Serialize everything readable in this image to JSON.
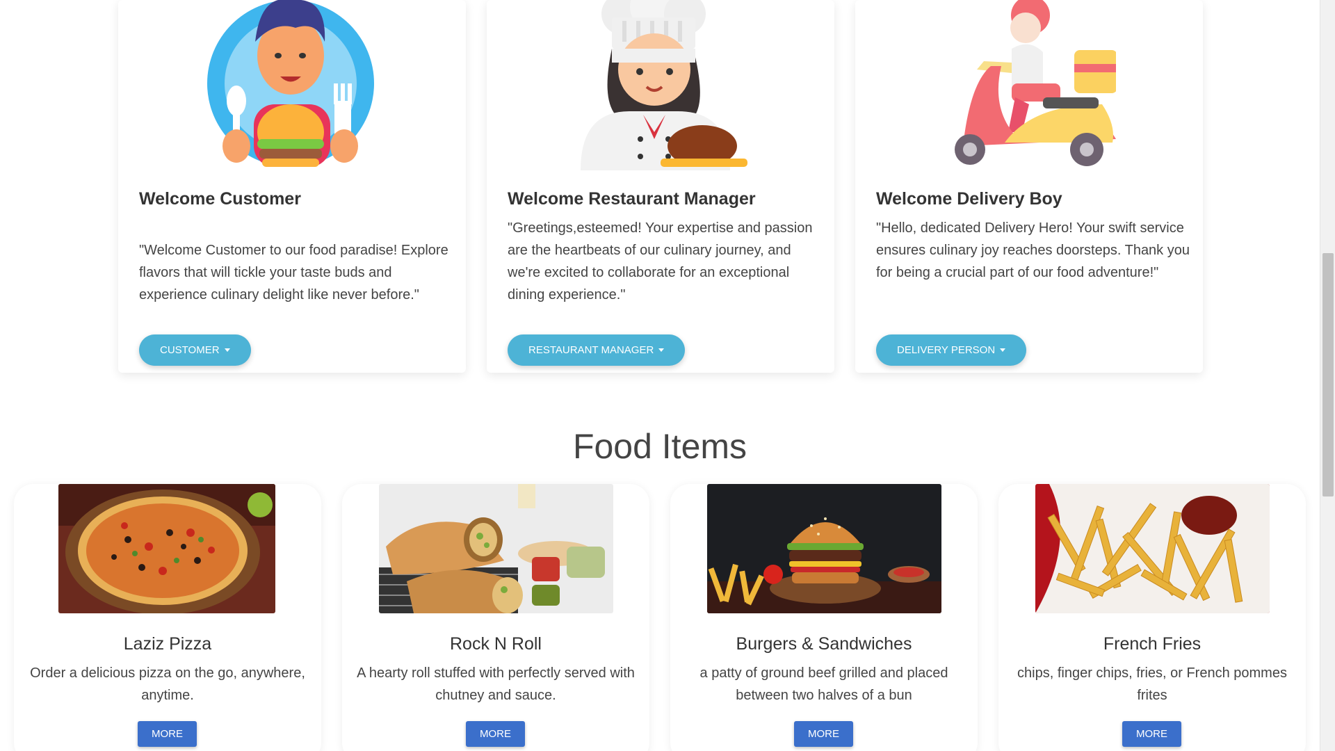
{
  "roles": [
    {
      "title": "Welcome Customer",
      "text": "\"Welcome Customer to our food paradise! Explore flavors that will tickle your taste buds and experience culinary delight like never before.\"",
      "button": "CUSTOMER"
    },
    {
      "title": "Welcome Restaurant Manager",
      "text": "\"Greetings,esteemed! Your expertise and passion are the heartbeats of our culinary journey, and we're excited to collaborate for an exceptional dining experience.\"",
      "button": "RESTAURANT MANAGER"
    },
    {
      "title": "Welcome Delivery Boy",
      "text": "\"Hello, dedicated Delivery Hero! Your swift service ensures culinary joy reaches doorsteps. Thank you for being a crucial part of our food adventure!\"",
      "button": "DELIVERY PERSON"
    }
  ],
  "food_section": {
    "title": "Food Items",
    "items": [
      {
        "name": "Laziz Pizza",
        "description": "Order a delicious pizza on the go, anywhere, anytime.",
        "button": "MORE"
      },
      {
        "name": "Rock N Roll",
        "description": "A hearty roll stuffed with perfectly served with chutney and sauce.",
        "button": "MORE"
      },
      {
        "name": "Burgers & Sandwiches",
        "description": "a patty of ground beef grilled and placed between two halves of a bun",
        "button": "MORE"
      },
      {
        "name": "French Fries",
        "description": "chips, finger chips, fries, or French pommes frites",
        "button": "MORE"
      }
    ]
  },
  "colors": {
    "role_button": "#4db3d6",
    "more_button": "#3b6fcb"
  }
}
